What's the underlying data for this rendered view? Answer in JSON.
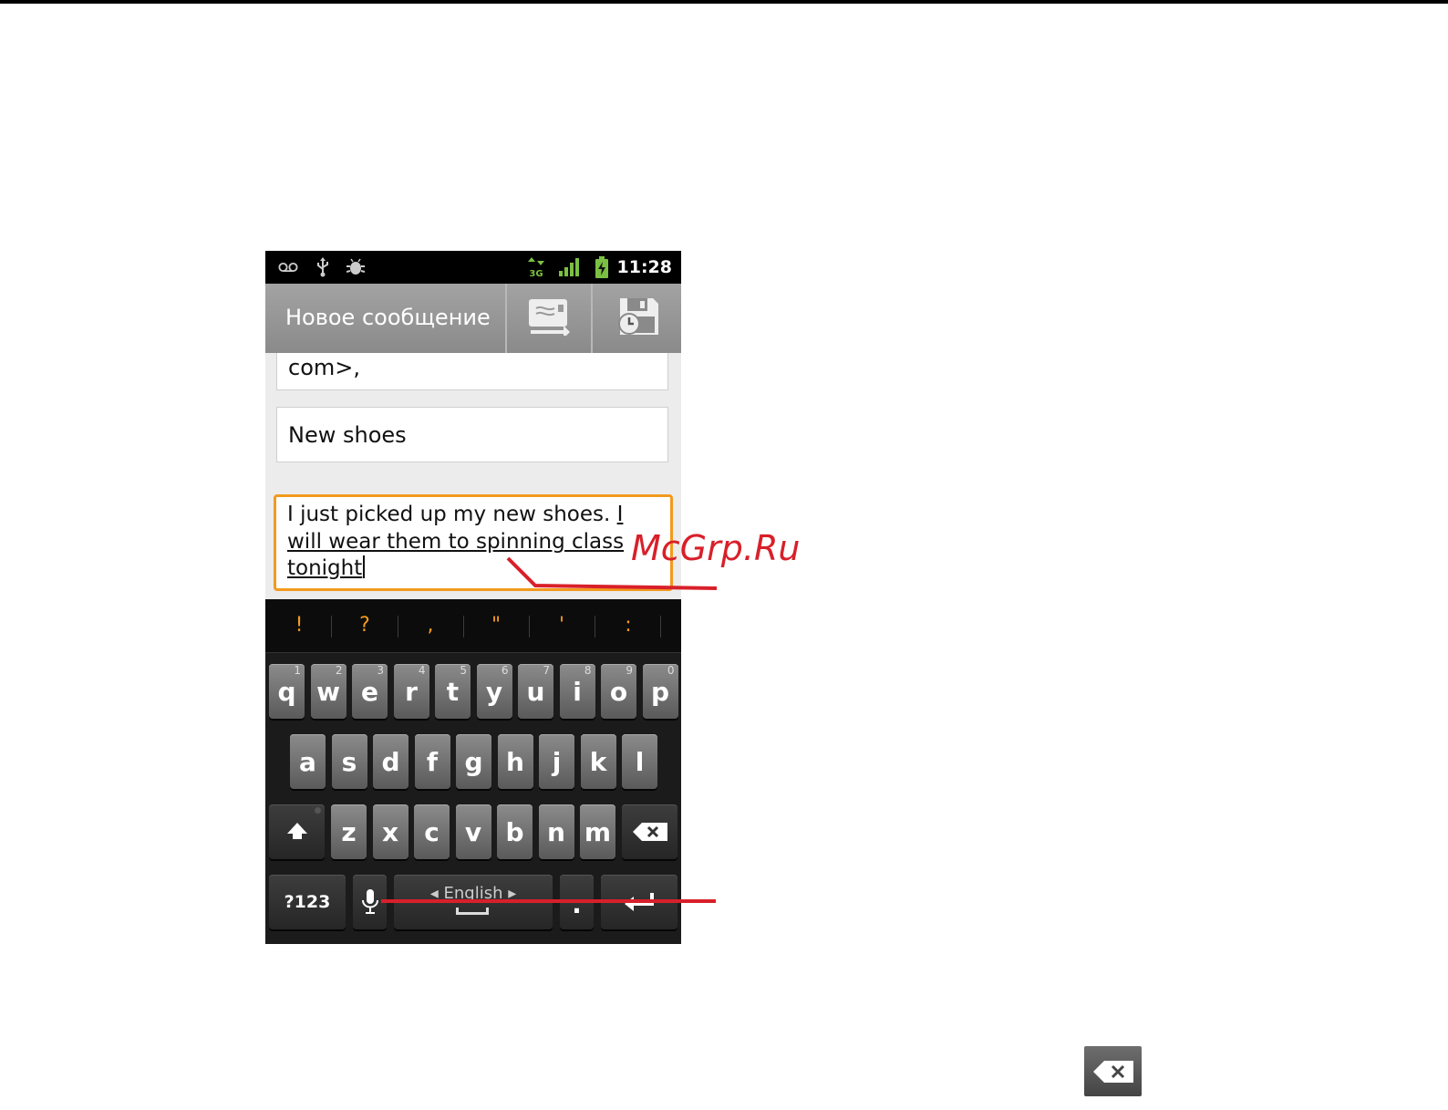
{
  "status_bar": {
    "time": "11:28",
    "network_type": "3G",
    "icons": [
      "voicemail-icon",
      "usb-icon",
      "android-debug-icon",
      "data-3g-icon",
      "signal-icon",
      "battery-charging-icon"
    ]
  },
  "action_bar": {
    "title": "Новое сообщение",
    "send_icon": "send-icon",
    "save_draft_icon": "save-draft-icon"
  },
  "compose": {
    "to_value": "com>,",
    "subject_value": "New shoes",
    "body_plain": "I just picked up my new shoes.",
    "body_composing": "I will wear them to spinning class tonight"
  },
  "keyboard": {
    "suggestions": [
      "!",
      "?",
      ",",
      "\"",
      "'",
      ":"
    ],
    "row1": [
      {
        "k": "q",
        "h": "1"
      },
      {
        "k": "w",
        "h": "2"
      },
      {
        "k": "e",
        "h": "3"
      },
      {
        "k": "r",
        "h": "4"
      },
      {
        "k": "t",
        "h": "5"
      },
      {
        "k": "y",
        "h": "6"
      },
      {
        "k": "u",
        "h": "7"
      },
      {
        "k": "i",
        "h": "8"
      },
      {
        "k": "o",
        "h": "9"
      },
      {
        "k": "p",
        "h": "0"
      }
    ],
    "row2": [
      "a",
      "s",
      "d",
      "f",
      "g",
      "h",
      "j",
      "k",
      "l"
    ],
    "row3": [
      "z",
      "x",
      "c",
      "v",
      "b",
      "n",
      "m"
    ],
    "symbols_label": "?123",
    "language_label": "English",
    "period_label": ".",
    "shift_icon": "shift-icon",
    "delete_icon": "backspace-icon",
    "mic_icon": "microphone-icon",
    "enter_icon": "enter-icon"
  },
  "watermark": "McGrp.Ru",
  "annotation_color": "#d8202a",
  "accent_color": "#f29a1e"
}
